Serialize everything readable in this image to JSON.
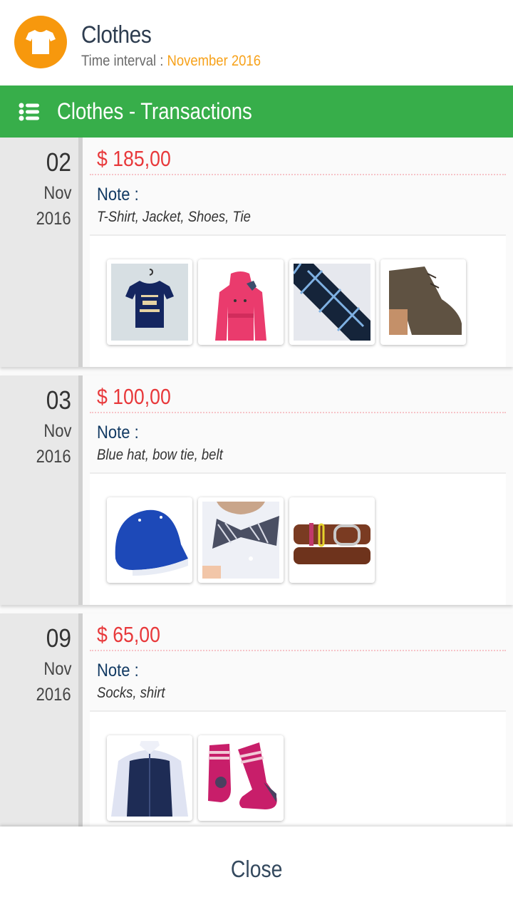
{
  "header": {
    "icon": "tshirt-icon",
    "icon_color": "#f7980d",
    "title": "Clothes",
    "interval_label": "Time interval : ",
    "interval_value": "November 2016",
    "accent_color": "#f7a21b"
  },
  "toolbar": {
    "icon": "list-icon",
    "title": "Clothes - Transactions",
    "color": "#37ae4a"
  },
  "transactions": [
    {
      "day": "02",
      "month": "Nov",
      "year": "2016",
      "amount": "$ 185,00",
      "note_label": "Note :",
      "note": "T-Shirt, Jacket, Shoes, Tie",
      "images": [
        "t-shirt-image",
        "pink-jacket-image",
        "tie-image",
        "shoe-image"
      ]
    },
    {
      "day": "03",
      "month": "Nov",
      "year": "2016",
      "amount": "$ 100,00",
      "note_label": "Note :",
      "note": "Blue hat, bow tie, belt",
      "images": [
        "blue-cap-image",
        "bow-tie-image",
        "belt-image"
      ]
    },
    {
      "day": "09",
      "month": "Nov",
      "year": "2016",
      "amount": "$ 65,00",
      "note_label": "Note :",
      "note": "Socks, shirt",
      "images": [
        "shirt-image",
        "socks-image"
      ]
    }
  ],
  "footer": {
    "close_label": "Close"
  },
  "colors": {
    "amount": "#e8393b",
    "note_label": "#123a63"
  }
}
